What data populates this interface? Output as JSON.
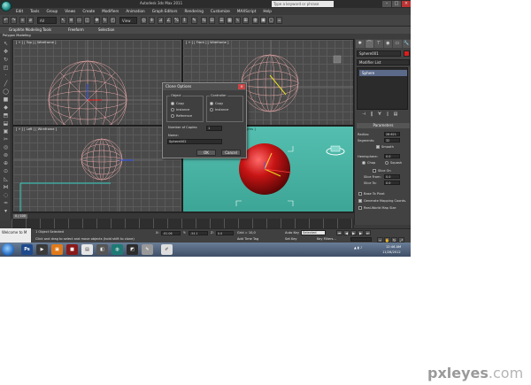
{
  "window": {
    "title": "Autodesk 3ds Max 2011",
    "search_placeholder": "Type a keyword or phrase"
  },
  "menubar": {
    "items": [
      "Edit",
      "Tools",
      "Group",
      "Views",
      "Create",
      "Modifiers",
      "Animation",
      "Graph Editors",
      "Rendering",
      "Customize",
      "MAXScript",
      "Help"
    ]
  },
  "toolbar": {
    "selection_filter": "All",
    "ref_coord": "View"
  },
  "ribbon": {
    "tabs": [
      "Graphite Modeling Tools",
      "Freeform",
      "Selection"
    ],
    "sub_label": "Polygon Modeling"
  },
  "viewports": {
    "top": "[ + ] [ Top ] [ Wireframe ]",
    "front": "[ + ] [ Front ] [ Wireframe ]",
    "left": "[ + ] [ Left ] [ Wireframe ]",
    "persp": "[ + ] [ Perspective ] [ Smooth + Highlights ]"
  },
  "command_panel": {
    "object_name": "Sphere001",
    "modifier_list": "Modifier List",
    "stack_item": "Sphere",
    "rollout": "Parameters",
    "radius_label": "Radius:",
    "radius_value": "28,621",
    "segments_label": "Segments:",
    "segments_value": "32",
    "smooth_label": "Smooth",
    "hemisphere_label": "Hemisphere:",
    "hemisphere_value": "0,0",
    "chop_label": "Chop",
    "squash_label": "Squash",
    "slice_on_label": "Slice On",
    "slice_from_label": "Slice From:",
    "slice_from_value": "0,0",
    "slice_to_label": "Slice To:",
    "slice_to_value": "0,0",
    "base_pivot_label": "Base To Pivot",
    "gen_mapping_label": "Generate Mapping Coords.",
    "real_world_label": "Real-World Map Size"
  },
  "dialog": {
    "title": "Clone Options",
    "object_group": "Object",
    "controller_group": "Controller",
    "copy": "Copy",
    "instance": "Instance",
    "reference": "Reference",
    "num_copies_label": "Number of Copies:",
    "num_copies_value": "1",
    "name_label": "Name:",
    "name_value": "Sphere002",
    "ok": "OK",
    "cancel": "Cancel"
  },
  "timeline": {
    "slider": "0 / 100"
  },
  "status": {
    "maxscript": "Welcome to M",
    "selected": "1 Object Selected",
    "prompt": "Click and drag to select and move objects (hold shift to clone)",
    "x_label": "X:",
    "x_value": "-81,06",
    "y_label": "Y:",
    "y_value": "-54,1",
    "z_label": "Z:",
    "z_value": "0,0",
    "grid": "Grid = 10,0",
    "add_time_tag": "Add Time Tag",
    "auto_key": "Auto Key",
    "set_key": "Set Key",
    "key_mode": "Selected",
    "key_filters": "Key Filters..."
  },
  "taskbar": {
    "time": "12:46 AM",
    "date": "11/28/2012"
  },
  "watermark": {
    "brand": "pxleyes",
    "domain": ".com"
  }
}
